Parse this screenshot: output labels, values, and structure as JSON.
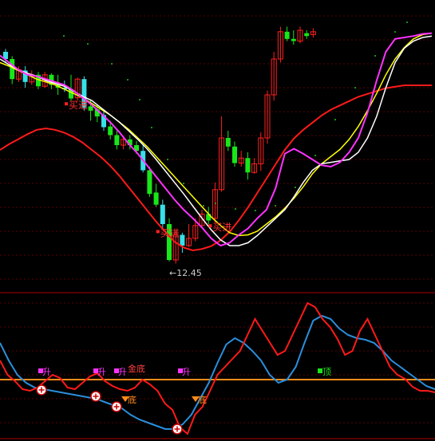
{
  "chart_data": [
    {
      "type": "candlestick",
      "panel": "price",
      "min_price_label": "←12.45",
      "annotations": [
        {
          "text": "买进",
          "bar": 10
        },
        {
          "text": "买进",
          "bar": 24
        },
        {
          "text": "买进",
          "bar": 32
        }
      ],
      "colors": {
        "up": "#ff2020",
        "down_cyan": "#38e0e8",
        "down_green": "#19e619",
        "ma_white": "#ffffff",
        "ma_yellow": "#ffff00",
        "ma_magenta": "#ff33ff",
        "ma_red": "#ff1a1a",
        "dots": "#19c219"
      },
      "bars": [
        [
          30,
          40,
          26,
          44
        ],
        [
          40,
          68,
          36,
          75
        ],
        [
          68,
          55,
          50,
          72
        ],
        [
          56,
          72,
          50,
          80
        ],
        [
          72,
          62,
          56,
          76
        ],
        [
          62,
          78,
          58,
          82
        ],
        [
          78,
          62,
          58,
          80
        ],
        [
          62,
          76,
          60,
          82
        ],
        [
          76,
          80,
          62,
          90
        ],
        [
          80,
          82,
          70,
          86
        ],
        [
          82,
          95,
          62,
          98
        ],
        [
          94,
          68,
          66,
          98
        ],
        [
          68,
          108,
          64,
          112
        ],
        [
          106,
          112,
          96,
          126
        ],
        [
          110,
          120,
          104,
          128
        ],
        [
          118,
          135,
          112,
          140
        ],
        [
          134,
          146,
          126,
          152
        ],
        [
          146,
          160,
          140,
          166
        ],
        [
          160,
          152,
          148,
          166
        ],
        [
          152,
          160,
          146,
          166
        ],
        [
          160,
          168,
          154,
          172
        ],
        [
          168,
          195,
          160,
          198
        ],
        [
          195,
          228,
          190,
          232
        ],
        [
          226,
          243,
          214,
          246
        ],
        [
          243,
          270,
          236,
          276
        ],
        [
          270,
          320,
          262,
          322
        ],
        [
          320,
          285,
          280,
          325
        ],
        [
          285,
          300,
          282,
          310
        ],
        [
          300,
          290,
          270,
          302
        ],
        [
          290,
          272,
          262,
          294
        ],
        [
          272,
          256,
          250,
          276
        ],
        [
          256,
          265,
          246,
          270
        ],
        [
          262,
          222,
          212,
          268
        ],
        [
          222,
          150,
          120,
          225
        ],
        [
          150,
          162,
          140,
          168
        ],
        [
          162,
          185,
          155,
          190
        ],
        [
          185,
          178,
          168,
          190
        ],
        [
          178,
          198,
          170,
          208
        ],
        [
          198,
          186,
          178,
          200
        ],
        [
          186,
          150,
          142,
          196
        ],
        [
          150,
          90,
          84,
          158
        ],
        [
          90,
          40,
          30,
          98
        ],
        [
          40,
          2,
          -5,
          45
        ],
        [
          2,
          12,
          -5,
          15
        ],
        [
          12,
          15,
          0,
          20
        ],
        [
          15,
          0,
          -5,
          18
        ],
        [
          4,
          8,
          0,
          12
        ],
        [
          6,
          2,
          -3,
          10
        ]
      ],
      "ma_white": [
        40,
        48,
        55,
        60,
        64,
        70,
        74,
        78,
        85,
        92,
        98,
        108,
        118,
        128,
        140,
        152,
        165,
        180,
        196,
        212,
        228,
        245,
        262,
        278,
        292,
        300,
        300,
        296,
        286,
        274,
        262,
        250,
        232,
        212,
        195,
        186,
        184,
        182,
        180,
        170,
        150,
        120,
        80,
        45,
        25,
        15,
        10,
        8
      ],
      "ma_yellow": [
        45,
        50,
        56,
        62,
        68,
        72,
        76,
        82,
        88,
        94,
        102,
        110,
        118,
        128,
        138,
        150,
        162,
        176,
        190,
        204,
        218,
        232,
        246,
        260,
        272,
        282,
        286,
        285,
        280,
        270,
        260,
        248,
        234,
        218,
        200,
        186,
        176,
        166,
        152,
        134,
        112,
        88,
        62,
        40,
        24,
        12,
        6,
        4
      ],
      "ma_magenta": [
        35,
        45,
        55,
        62,
        64,
        68,
        72,
        76,
        84,
        94,
        104,
        116,
        128,
        142,
        158,
        172,
        188,
        204,
        220,
        236,
        250,
        262,
        275,
        290,
        300,
        296,
        285,
        276,
        262,
        250,
        220,
        172,
        165,
        172,
        180,
        188,
        190,
        184,
        170,
        150,
        115,
        70,
        30,
        12,
        10,
        8,
        5,
        4
      ],
      "ma_red": [
        100,
        92,
        85,
        78,
        72,
        70,
        72,
        76,
        82,
        90,
        100,
        110,
        122,
        136,
        152,
        168,
        184,
        200,
        214,
        228,
        236,
        240,
        238,
        234,
        226,
        214,
        198,
        180,
        160,
        140,
        120,
        100,
        84,
        72,
        62,
        52,
        44,
        38,
        32,
        26,
        22,
        18,
        14,
        12,
        10,
        10,
        10,
        10
      ],
      "dots": [
        [
          80,
          45
        ],
        [
          110,
          55
        ],
        [
          140,
          80
        ],
        [
          160,
          100
        ],
        [
          175,
          125
        ],
        [
          190,
          160
        ],
        [
          210,
          200
        ],
        [
          230,
          230
        ],
        [
          255,
          258
        ],
        [
          270,
          255
        ],
        [
          295,
          262
        ],
        [
          320,
          264
        ],
        [
          345,
          258
        ],
        [
          370,
          235
        ],
        [
          395,
          195
        ],
        [
          420,
          150
        ],
        [
          445,
          110
        ],
        [
          470,
          70
        ],
        [
          495,
          40
        ],
        [
          510,
          28
        ]
      ]
    },
    {
      "type": "line",
      "panel": "indicator",
      "labels": [
        {
          "text": "升",
          "bar": 5
        },
        {
          "text": "升",
          "bar": 14
        },
        {
          "text": "升",
          "bar": 18
        },
        {
          "text": "金底",
          "bar": 20
        },
        {
          "text": "升",
          "bar": 31
        },
        {
          "text": "底",
          "bar": 21
        },
        {
          "text": "底",
          "bar": 33
        },
        {
          "text": "顶",
          "bar": 49
        }
      ],
      "reference_level": 476,
      "red_line": [
        452,
        470,
        478,
        488,
        490,
        486,
        478,
        470,
        474,
        486,
        488,
        480,
        472,
        468,
        478,
        484,
        488,
        490,
        486,
        476,
        482,
        490,
        506,
        514,
        536,
        544,
        520,
        510,
        490,
        470,
        460,
        450,
        440,
        420,
        400,
        415,
        430,
        445,
        440,
        420,
        400,
        380,
        385,
        400,
        410,
        425,
        445,
        440,
        415,
        400,
        420,
        440,
        460,
        470,
        475,
        485,
        490,
        490,
        492
      ],
      "blue_line": [
        430,
        452,
        470,
        480,
        486,
        488,
        490,
        492,
        494,
        496,
        498,
        500,
        504,
        508,
        512,
        520,
        526,
        530,
        534,
        538,
        538,
        532,
        520,
        500,
        480,
        455,
        432,
        424,
        430,
        440,
        452,
        470,
        480,
        476,
        460,
        430,
        402,
        396,
        400,
        412,
        420,
        424,
        426,
        430,
        440,
        452,
        460,
        468,
        476,
        484,
        488
      ]
    }
  ]
}
